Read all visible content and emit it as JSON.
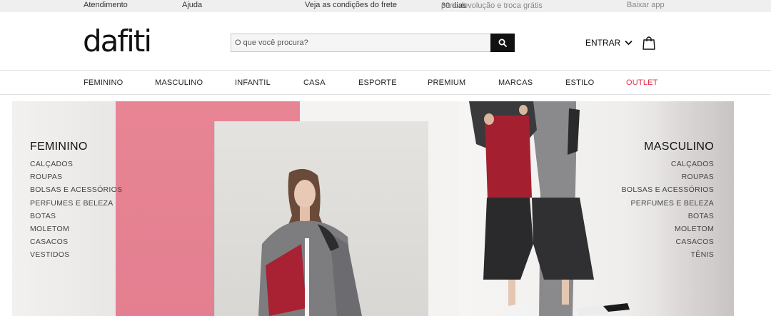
{
  "topbar": {
    "atendimento": "Atendimento",
    "ajuda": "Ajuda",
    "frete": "Veja as condições do frete",
    "troca_days": "30 dias",
    "troca_text": " para devolução e troca grátis",
    "app": "Baixar app"
  },
  "header": {
    "logo": "dafiti",
    "search_placeholder": "O que você procura?",
    "login_label": "ENTRAR"
  },
  "nav": {
    "items": [
      "FEMININO",
      "MASCULINO",
      "INFANTIL",
      "CASA",
      "ESPORTE",
      "PREMIUM",
      "MARCAS",
      "ESTILO",
      "OUTLET"
    ]
  },
  "hero": {
    "left": {
      "title": "FEMININO",
      "items": [
        "CALÇADOS",
        "ROUPAS",
        "BOLSAS E ACESSÓRIOS",
        "PERFUMES E BELEZA",
        "BOTAS",
        "MOLETOM",
        "CASACOS",
        "VESTIDOS"
      ]
    },
    "right": {
      "title": "MASCULINO",
      "items": [
        "CALÇADOS",
        "ROUPAS",
        "BOLSAS E ACESSÓRIOS",
        "PERFUMES E BELEZA",
        "BOTAS",
        "MOLETOM",
        "CASACOS",
        "TÊNIS"
      ]
    }
  },
  "colors": {
    "accent_outlet": "#e0314a",
    "banner_pink": "#e88594",
    "search_button": "#111111"
  },
  "icons": [
    "search-icon",
    "chevron-down-icon",
    "shopping-bag-icon"
  ]
}
